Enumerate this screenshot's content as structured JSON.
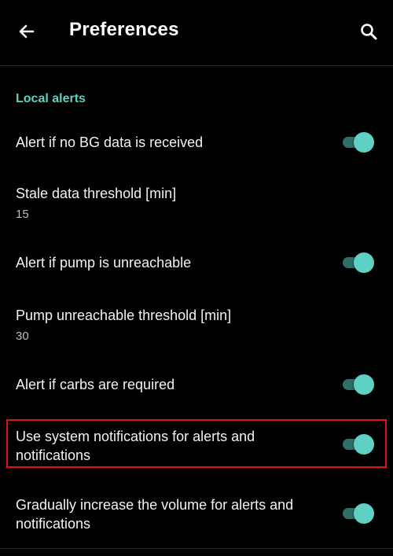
{
  "appbar": {
    "title": "Preferences",
    "back_icon": "arrow-left-icon",
    "search_icon": "search-icon"
  },
  "section": {
    "header": "Local alerts"
  },
  "items": [
    {
      "title": "Alert if no BG data is received",
      "toggle": true
    },
    {
      "title": "Stale data threshold [min]",
      "value": "15"
    },
    {
      "title": "Alert if pump is unreachable",
      "toggle": true
    },
    {
      "title": "Pump unreachable threshold [min]",
      "value": "30"
    },
    {
      "title": "Alert if carbs are required",
      "toggle": true
    },
    {
      "title": "Use system notifications for alerts and notifications",
      "toggle": true
    },
    {
      "title": "Gradually increase the volume for alerts and notifications",
      "toggle": true
    }
  ],
  "colors": {
    "accent": "#5fd1c4",
    "highlight": "#e0101a",
    "background": "#000000"
  }
}
